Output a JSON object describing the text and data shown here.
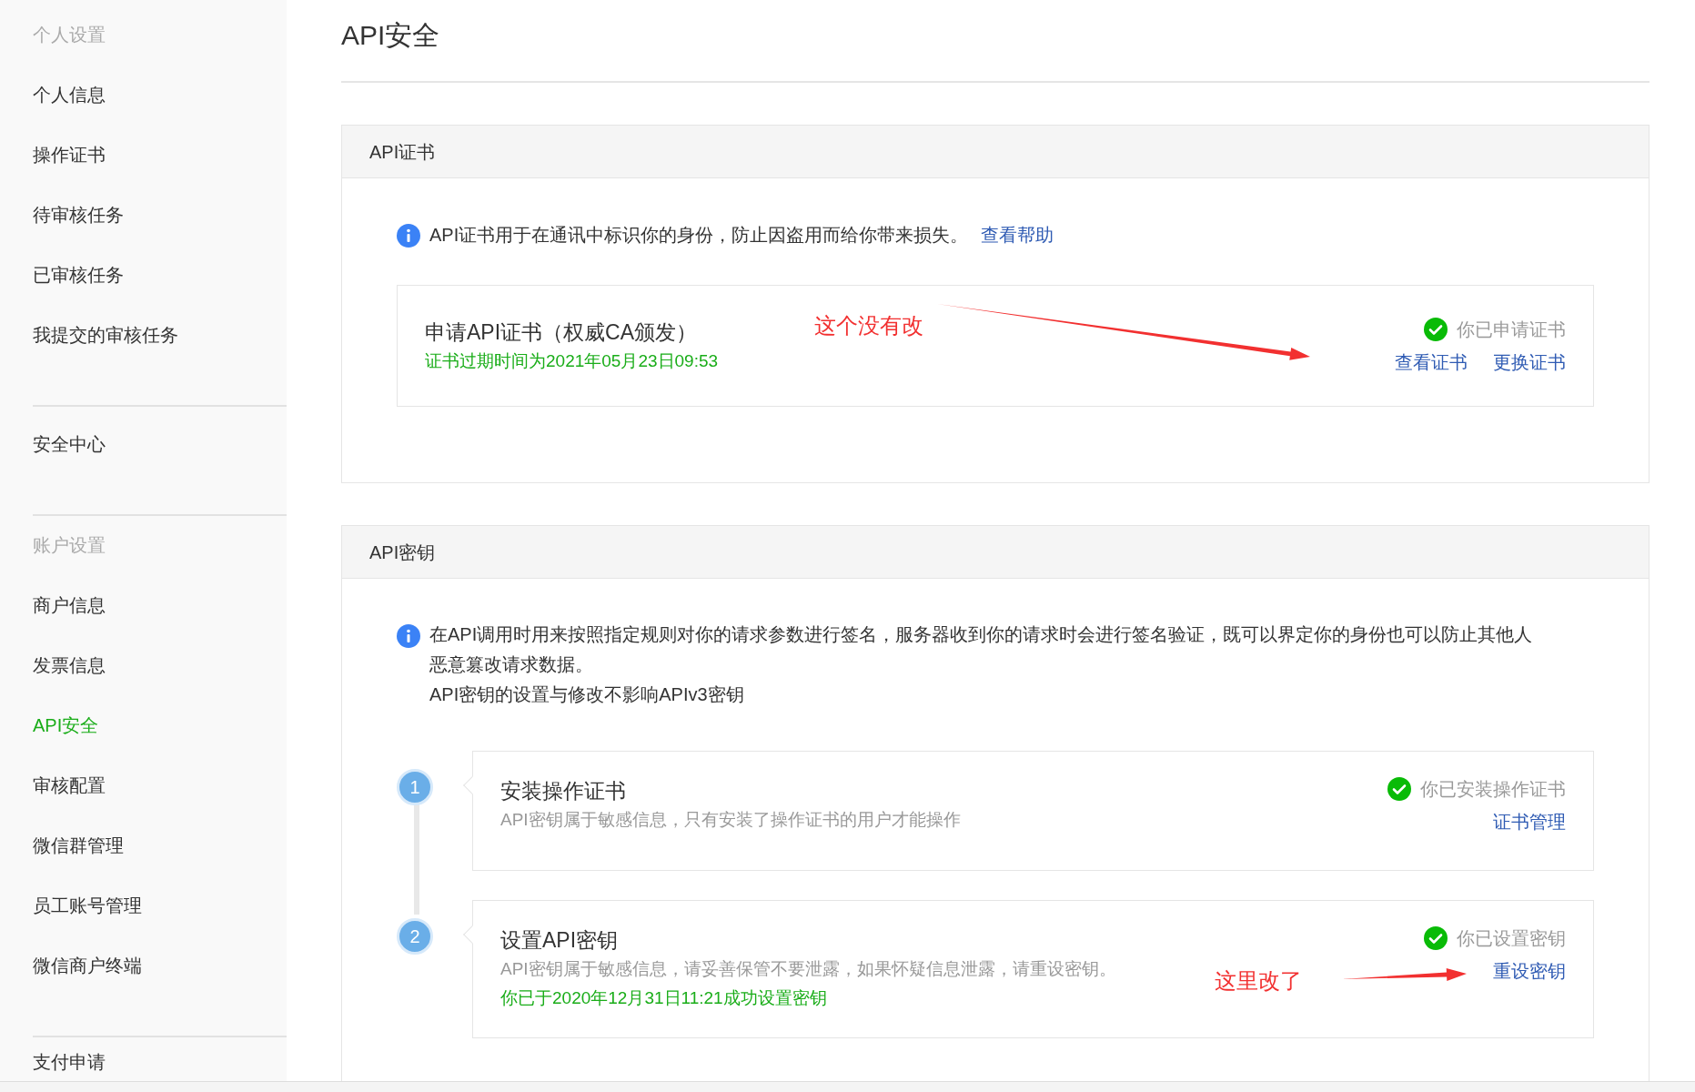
{
  "sidebar": {
    "sections": [
      {
        "heading": "个人设置",
        "items": [
          {
            "label": "个人信息",
            "selected": false
          },
          {
            "label": "操作证书",
            "selected": false
          },
          {
            "label": "待审核任务",
            "selected": false
          },
          {
            "label": "已审核任务",
            "selected": false
          },
          {
            "label": "我提交的审核任务",
            "selected": false
          }
        ]
      },
      {
        "items": [
          {
            "label": "安全中心",
            "selected": false
          }
        ]
      },
      {
        "heading": "账户设置",
        "items": [
          {
            "label": "商户信息",
            "selected": false
          },
          {
            "label": "发票信息",
            "selected": false
          },
          {
            "label": "API安全",
            "selected": true
          },
          {
            "label": "审核配置",
            "selected": false
          },
          {
            "label": "微信群管理",
            "selected": false
          },
          {
            "label": "员工账号管理",
            "selected": false
          },
          {
            "label": "微信商户终端",
            "selected": false
          }
        ]
      },
      {
        "items": [
          {
            "label": "支付申请",
            "selected": false
          }
        ]
      }
    ]
  },
  "page_title": "API安全",
  "cert_panel": {
    "title": "API证书",
    "info": "API证书用于在通讯中标识你的身份，防止因盗用而给你带来损失。",
    "help_link": "查看帮助",
    "card": {
      "title": "申请API证书（权威CA颁发）",
      "note": "证书过期时间为2021年05月23日09:53",
      "status": "你已申请证书",
      "links": [
        "查看证书",
        "更换证书"
      ],
      "annotation": "这个没有改"
    }
  },
  "key_panel": {
    "title": "API密钥",
    "info": "在API调用时用来按照指定规则对你的请求参数进行签名，服务器收到你的请求时会进行签名验证，既可以界定你的身份也可以防止其他人恶意篡改请求数据。",
    "info_extra": "API密钥的设置与修改不影响APIv3密钥",
    "steps": [
      {
        "number": "1",
        "title": "安装操作证书",
        "description": "API密钥属于敏感信息，只有安装了操作证书的用户才能操作",
        "status": "你已安装操作证书",
        "links": [
          "证书管理"
        ]
      },
      {
        "number": "2",
        "title": "设置API密钥",
        "description": "API密钥属于敏感信息，请妥善保管不要泄露，如果怀疑信息泄露，请重设密钥。",
        "note": "你已于2020年12月31日11:21成功设置密钥",
        "status": "你已设置密钥",
        "links": [
          "重设密钥"
        ],
        "annotation": "这里改了"
      }
    ]
  }
}
